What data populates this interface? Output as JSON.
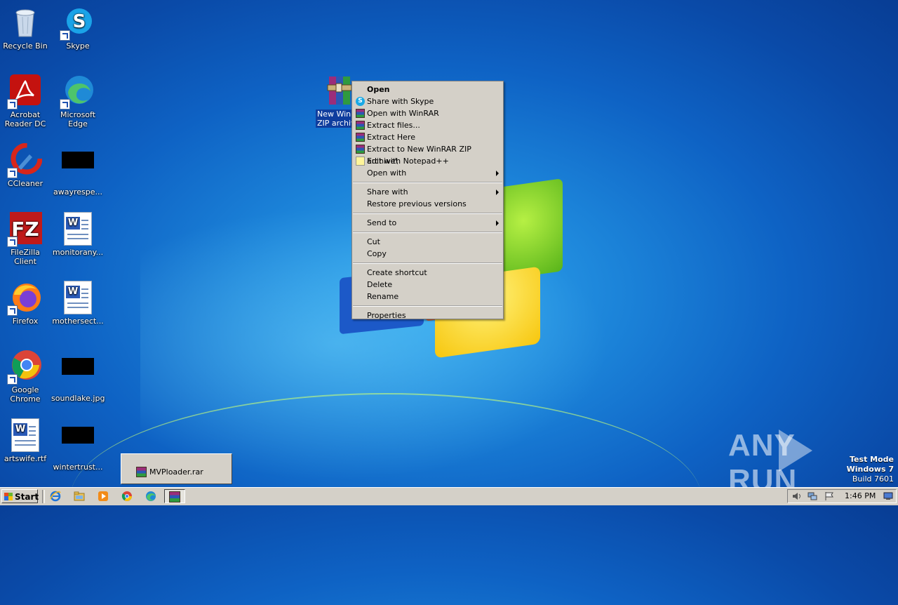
{
  "desktop": {
    "icons": [
      {
        "label": "Recycle Bin",
        "icon": "recycle-bin-icon"
      },
      {
        "label": "Skype",
        "icon": "skype-icon"
      },
      {
        "label": "Acrobat Reader DC",
        "icon": "acrobat-icon"
      },
      {
        "label": "Microsoft Edge",
        "icon": "edge-icon"
      },
      {
        "label": "CCleaner",
        "icon": "ccleaner-icon"
      },
      {
        "label": "awayrespe...",
        "icon": "image-file-icon"
      },
      {
        "label": "FileZilla Client",
        "icon": "filezilla-icon"
      },
      {
        "label": "monitorany...",
        "icon": "word-doc-icon"
      },
      {
        "label": "Firefox",
        "icon": "firefox-icon"
      },
      {
        "label": "mothersect...",
        "icon": "word-doc-icon"
      },
      {
        "label": "Google Chrome",
        "icon": "chrome-icon"
      },
      {
        "label": "soundlake.jpg",
        "icon": "image-file-icon"
      },
      {
        "label": "artswife.rtf",
        "icon": "word-doc-icon"
      },
      {
        "label": "wintertrust...",
        "icon": "image-file-icon"
      }
    ],
    "selected_icon": {
      "label": "New WinRAR ZIP archive",
      "label_visible_line1": "New WinR",
      "label_visible_line2": "ZIP archiv",
      "icon": "winrar-archive-icon"
    }
  },
  "context_menu": {
    "groups": [
      [
        {
          "label": "Open",
          "bold": true,
          "icon": "",
          "submenu": false
        },
        {
          "label": "Share with Skype",
          "icon": "skype-icon",
          "submenu": false
        },
        {
          "label": "Open with WinRAR",
          "icon": "winrar-icon",
          "submenu": false
        },
        {
          "label": "Extract files...",
          "icon": "winrar-icon",
          "submenu": false
        },
        {
          "label": "Extract Here",
          "icon": "winrar-icon",
          "submenu": false
        },
        {
          "label": "Extract to New WinRAR ZIP archive\\",
          "icon": "winrar-icon",
          "submenu": false
        },
        {
          "label": "Edit with Notepad++",
          "icon": "notepadpp-icon",
          "submenu": false
        },
        {
          "label": "Open with",
          "icon": "",
          "submenu": true
        }
      ],
      [
        {
          "label": "Share with",
          "icon": "",
          "submenu": true
        },
        {
          "label": "Restore previous versions",
          "icon": "",
          "submenu": false
        }
      ],
      [
        {
          "label": "Send to",
          "icon": "",
          "submenu": true
        }
      ],
      [
        {
          "label": "Cut",
          "icon": "",
          "submenu": false
        },
        {
          "label": "Copy",
          "icon": "",
          "submenu": false
        }
      ],
      [
        {
          "label": "Create shortcut",
          "icon": "",
          "submenu": false
        },
        {
          "label": "Delete",
          "icon": "",
          "submenu": false
        },
        {
          "label": "Rename",
          "icon": "",
          "submenu": false
        }
      ],
      [
        {
          "label": "Properties",
          "icon": "",
          "submenu": false
        }
      ]
    ]
  },
  "taskbar": {
    "start_label": "Start",
    "quick_launch": [
      "ie-icon",
      "explorer-icon",
      "media-player-icon",
      "chrome-icon",
      "edge-icon",
      "winrar-icon"
    ],
    "clock": "1:46 PM",
    "tray_icons": [
      "speaker-icon",
      "network-icon",
      "flag-icon",
      "show-desktop-icon"
    ]
  },
  "taskbar_preview": {
    "label": "MVPloader.rar",
    "icon": "winrar-icon"
  },
  "watermark": {
    "text_left": "ANY",
    "text_right": "RUN"
  },
  "system_notice": {
    "line1": "Test Mode",
    "line2": "Windows 7",
    "line3": "Build 7601"
  },
  "colors": {
    "menu_bg": "#d4d0c8",
    "selection": "#0f3d9e",
    "desktop_blue": "#1b82d8"
  }
}
